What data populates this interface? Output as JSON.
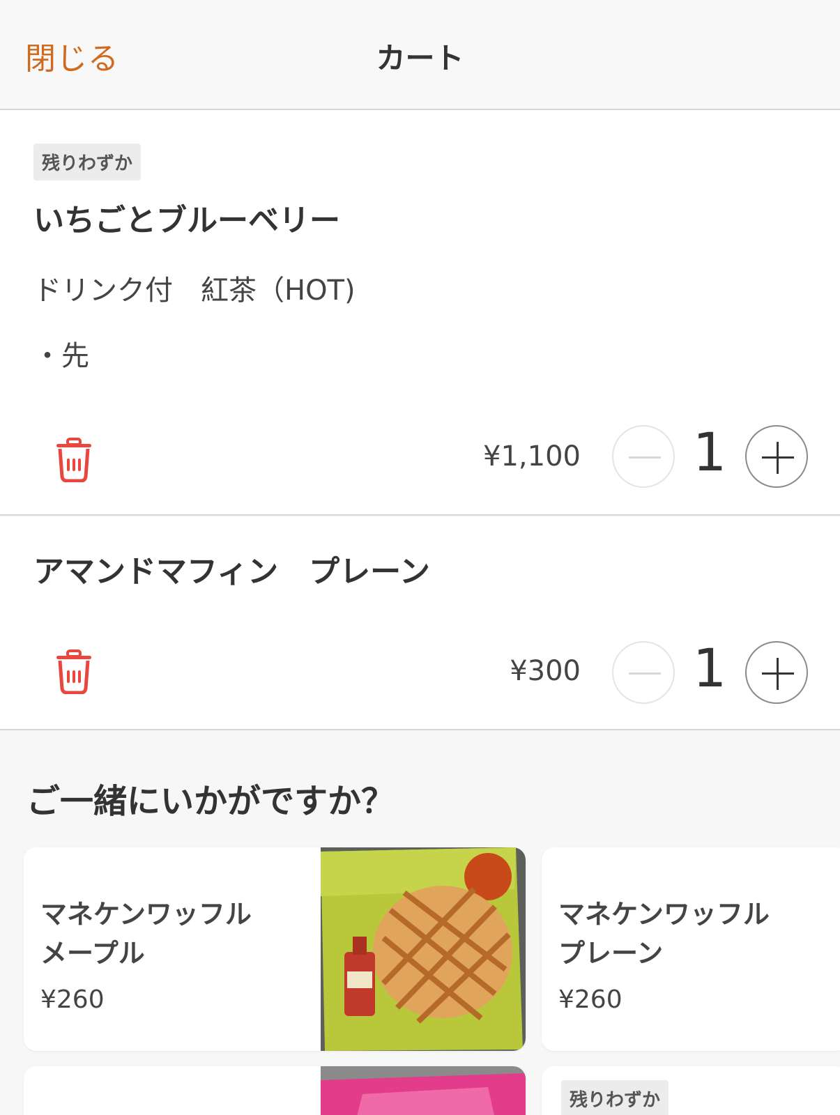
{
  "header": {
    "close_label": "閉じる",
    "title": "カート"
  },
  "cart": {
    "items": [
      {
        "badge": "残りわずか",
        "name": "いちごとブルーベリー",
        "options": [
          "ドリンク付　紅茶（HOT)",
          "・先"
        ],
        "price": "¥1,100",
        "quantity": "1"
      },
      {
        "name": "アマンドマフィン　プレーン",
        "price": "¥300",
        "quantity": "1"
      }
    ]
  },
  "recommendations": {
    "title": "ご一緒にいかがですか？",
    "items": [
      {
        "name_line1": "マネケンワッフル",
        "name_line2": "メープル",
        "price": "¥260"
      },
      {
        "name_line1": "マネケンワッフル",
        "name_line2": "プレーン",
        "price": "¥260"
      },
      {
        "badge": "残りわずか"
      }
    ]
  },
  "colors": {
    "accent": "#d06a1f",
    "delete": "#e8463f"
  }
}
